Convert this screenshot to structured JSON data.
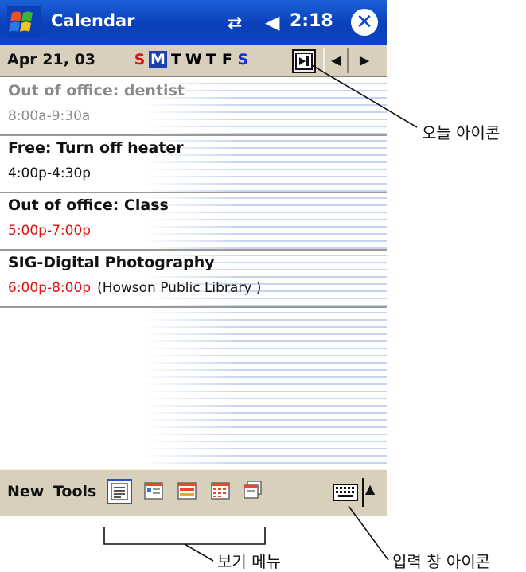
{
  "title_bar": {
    "app_title": "Calendar",
    "clock": "2:18"
  },
  "date_bar": {
    "date": "Apr 21, 03",
    "weekdays": [
      "S",
      "M",
      "T",
      "W",
      "T",
      "F",
      "S"
    ],
    "selected_weekday_index": 1
  },
  "appointments": [
    {
      "title": "Out of office: dentist",
      "time": "8:00a-9:30a",
      "location": ""
    },
    {
      "title": "Free: Turn off heater",
      "time": "4:00p-4:30p",
      "location": ""
    },
    {
      "title": "Out of office: Class",
      "time": "5:00p-7:00p",
      "location": ""
    },
    {
      "title": "SIG-Digital Photography",
      "time": "6:00p-8:00p",
      "location": "(Howson Public Library )"
    }
  ],
  "menu_bar": {
    "new_label": "New",
    "tools_label": "Tools"
  },
  "callouts": {
    "today_icon": "오늘 아이콘",
    "view_menu": "보기 메뉴",
    "input_panel_icon": "입력 창 아이콘"
  },
  "colors": {
    "title_bar": "#0c46c2",
    "conflict_time": "#e01010",
    "sunday": "#e01010",
    "saturday": "#1030e0"
  }
}
